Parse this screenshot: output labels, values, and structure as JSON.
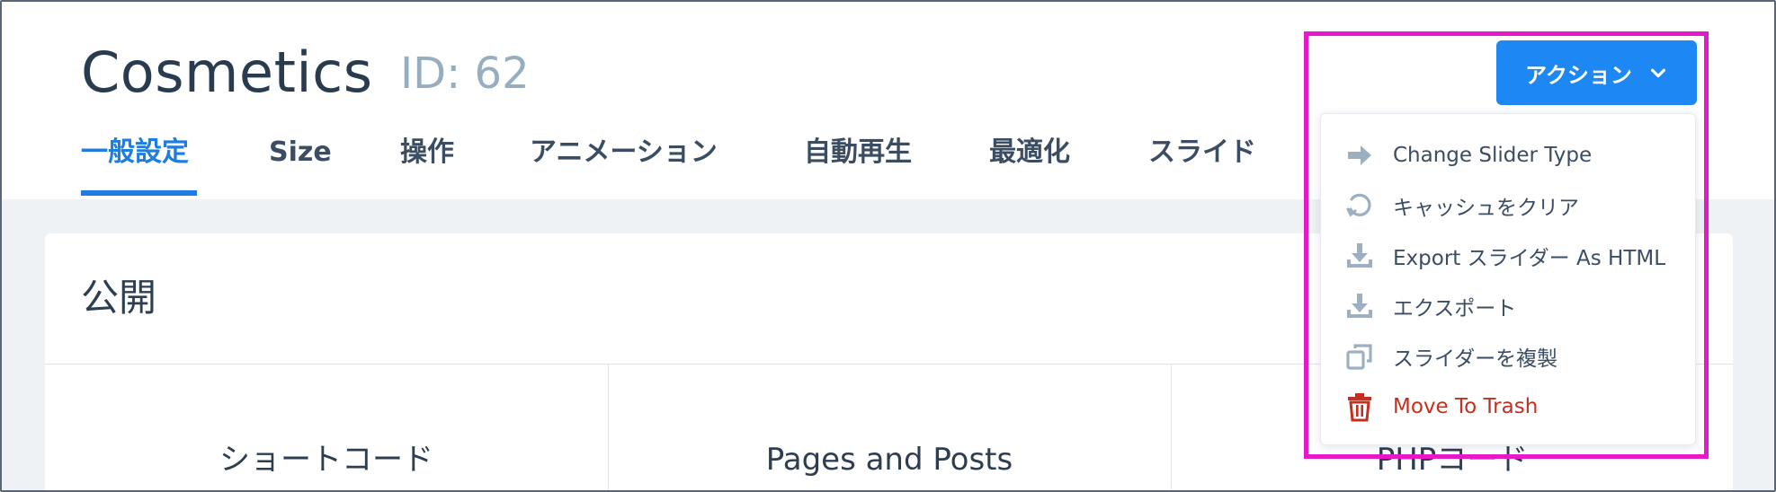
{
  "header": {
    "title": "Cosmetics",
    "id_label": "ID: 62"
  },
  "tabs": [
    {
      "label": "一般設定",
      "active": true
    },
    {
      "label": "Size",
      "active": false
    },
    {
      "label": "操作",
      "active": false
    },
    {
      "label": "アニメーション",
      "active": false
    },
    {
      "label": "自動再生",
      "active": false
    },
    {
      "label": "最適化",
      "active": false
    },
    {
      "label": "スライド",
      "active": false
    }
  ],
  "actions": {
    "button_label": "アクション",
    "items": [
      {
        "label": "Change Slider Type",
        "icon": "arrow-right-icon"
      },
      {
        "label": "キャッシュをクリア",
        "icon": "refresh-icon"
      },
      {
        "label": "Export スライダー As HTML",
        "icon": "download-icon"
      },
      {
        "label": "エクスポート",
        "icon": "download-icon"
      },
      {
        "label": "スライダーを複製",
        "icon": "duplicate-icon"
      },
      {
        "label": "Move To Trash",
        "icon": "trash-icon"
      }
    ]
  },
  "publish": {
    "title": "公開",
    "columns": [
      "ショートコード",
      "Pages and Posts",
      "PHPコード"
    ]
  },
  "colors": {
    "accent": "#1d87f3",
    "active_tab": "#1d7de0",
    "danger": "#c3301f",
    "highlight": "#e619c8"
  }
}
